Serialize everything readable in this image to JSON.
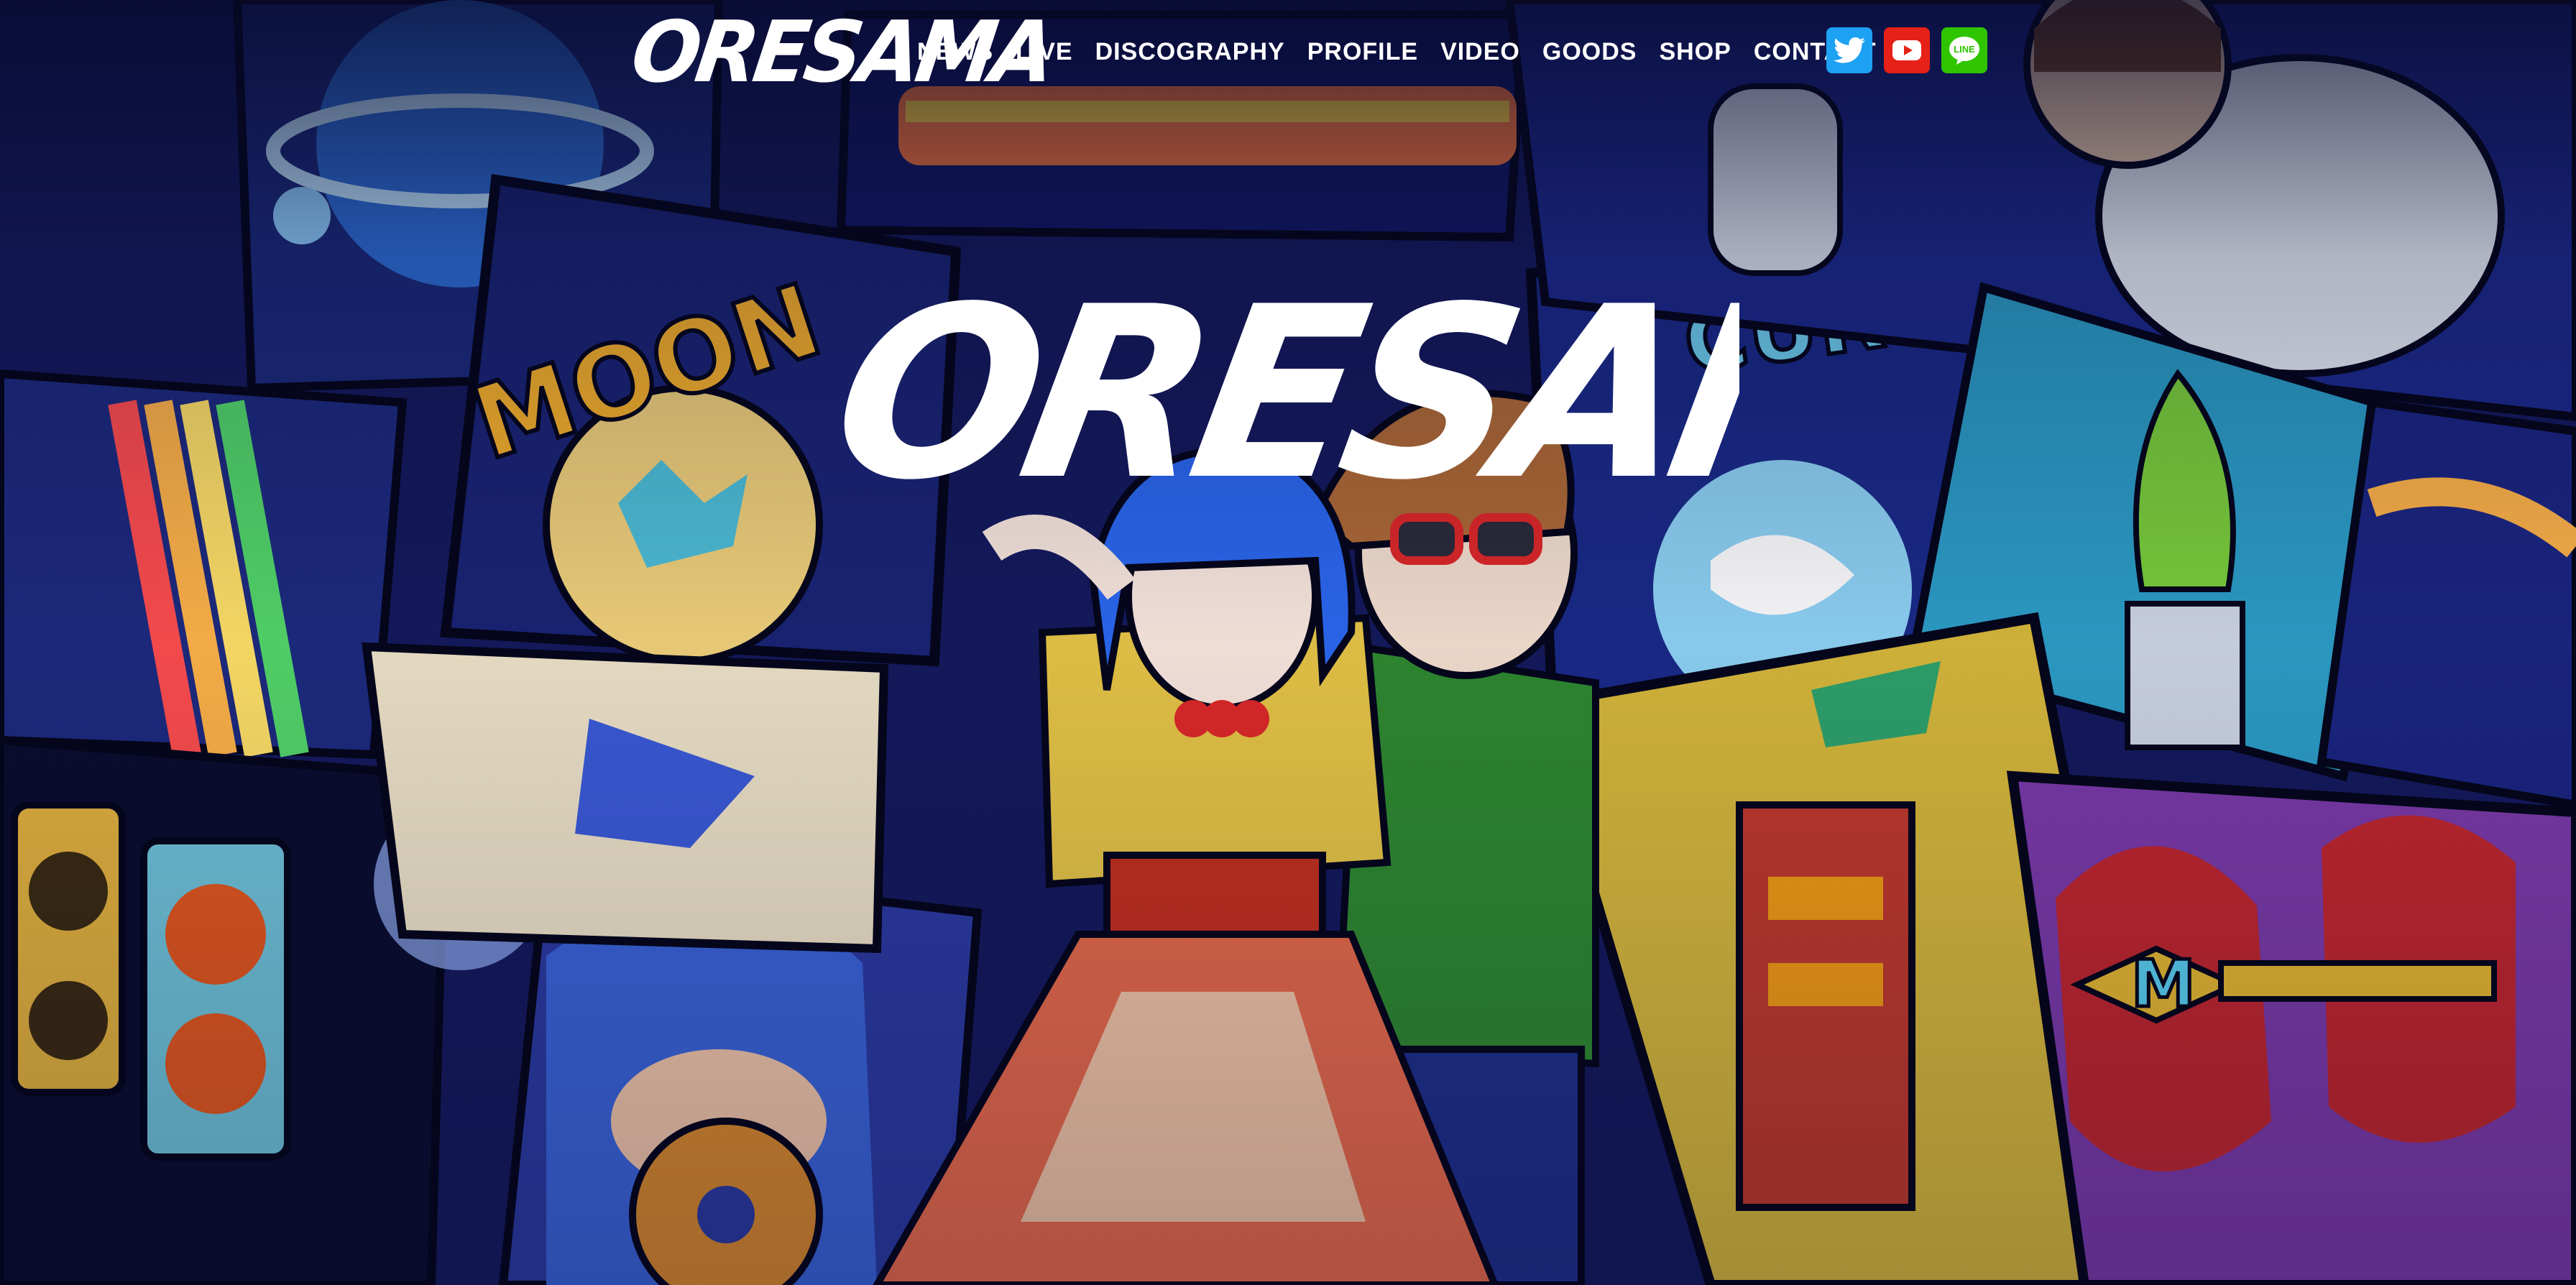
{
  "brand": {
    "logo_text": "ORESAMA"
  },
  "nav": {
    "items": [
      {
        "label": "NEWS"
      },
      {
        "label": "LIVE"
      },
      {
        "label": "DISCOGRAPHY"
      },
      {
        "label": "PROFILE"
      },
      {
        "label": "VIDEO"
      },
      {
        "label": "GOODS"
      },
      {
        "label": "SHOP"
      },
      {
        "label": "CONTACT"
      }
    ]
  },
  "social": {
    "twitter_icon": "twitter-icon",
    "youtube_icon": "youtube-icon",
    "line_icon": "line-icon",
    "line_text": "LINE"
  },
  "hero": {
    "logo_text": "ORESAMA",
    "panel_moon": "MOON",
    "panel_mercury": "CURY",
    "key_letter": "M"
  },
  "colors": {
    "background": "#0b0f3a",
    "twitter": "#1da1f2",
    "youtube": "#e62117",
    "line": "#2ec400"
  }
}
